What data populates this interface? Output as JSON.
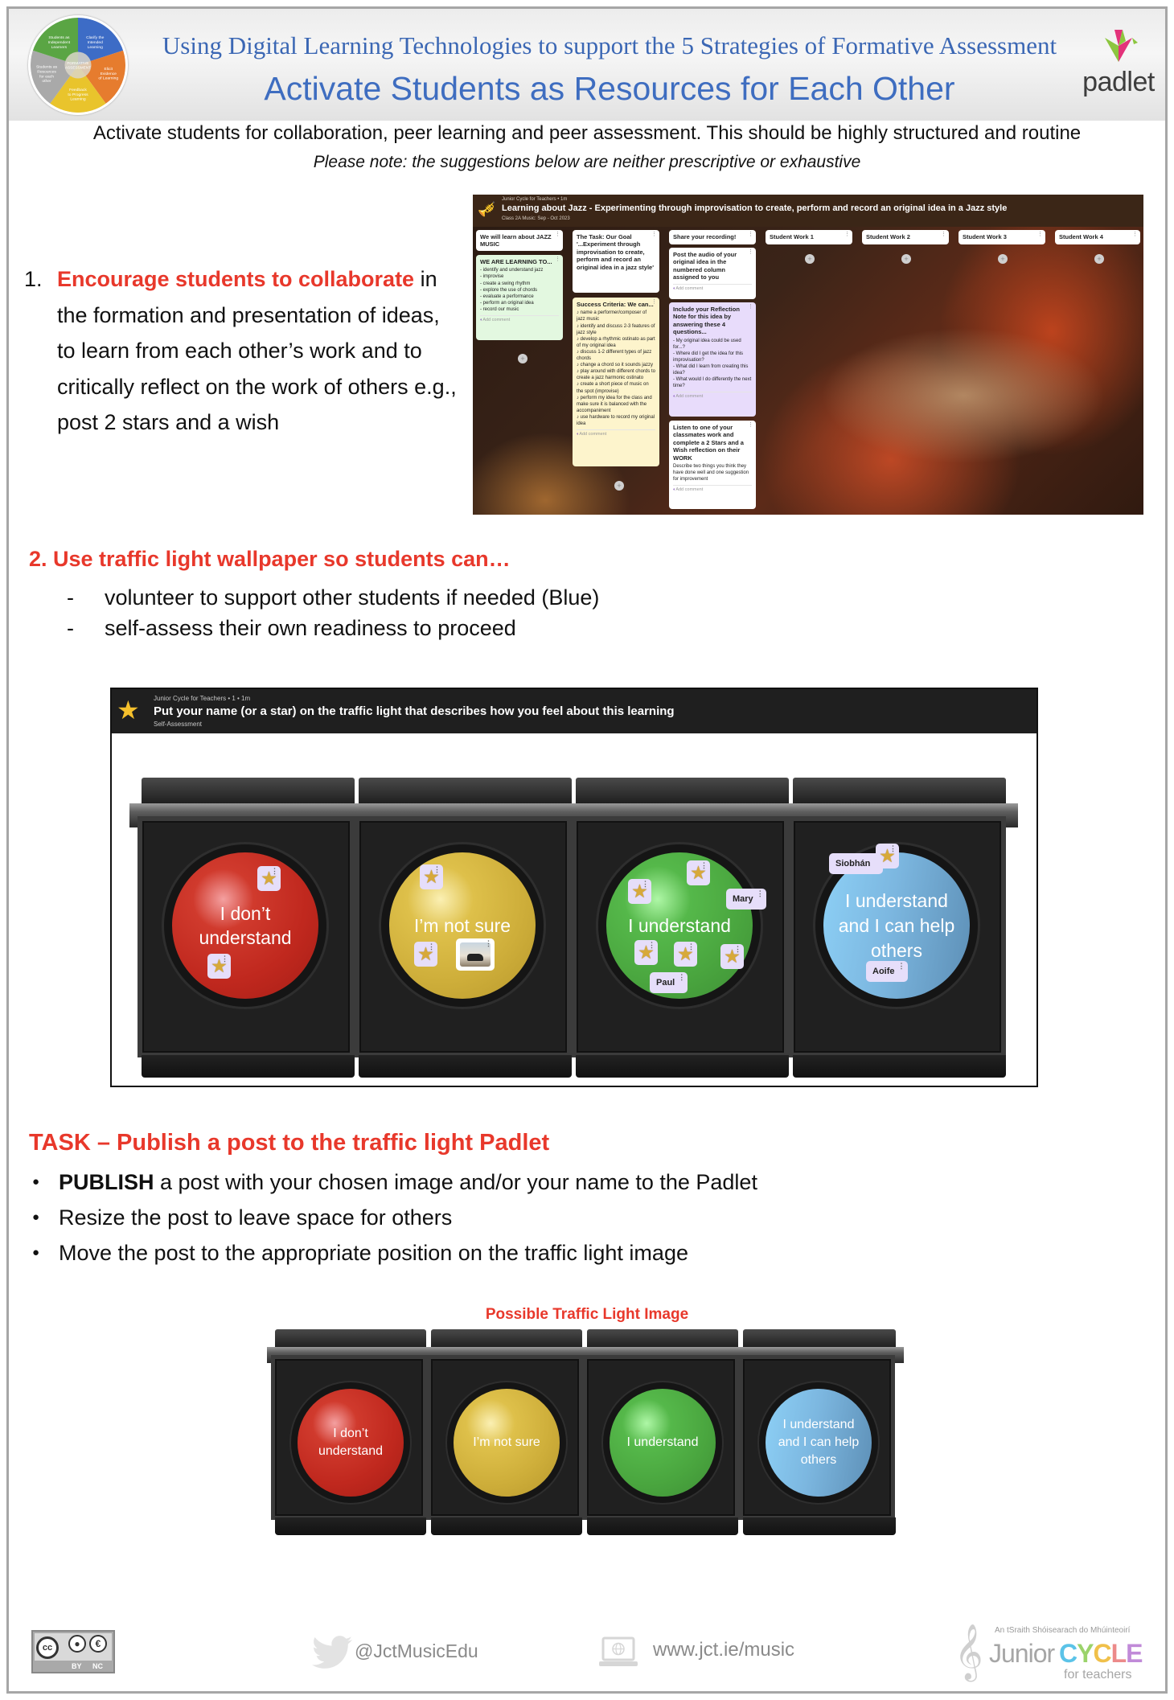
{
  "header": {
    "subtitle": "Using Digital Learning Technologies to support the 5 Strategies of Formative Assessment",
    "title": "Activate Students as Resources for Each Other",
    "brand": "padlet",
    "wheel": {
      "center": "FORMATIVE ASSESSMENT",
      "segments": [
        {
          "label": "Students as Independent Learners",
          "color": "#5aa544"
        },
        {
          "label": "Clarify the Intended Learning",
          "color": "#3d6cc6"
        },
        {
          "label": "Elicit Evidence of Learning",
          "color": "#e67c2e"
        },
        {
          "label": "Feedback to Progress Learning",
          "color": "#e9c42c"
        },
        {
          "label": "Students as Resources for each other",
          "color": "#a9a9a9"
        }
      ]
    }
  },
  "intro": "Activate students for collaboration, peer learning and peer assessment. This should be highly structured and routine",
  "note": "Please note: the suggestions below are neither prescriptive or exhaustive",
  "section1": {
    "number": "1.",
    "highlight": "Encourage students to collaborate",
    "rest": " in the formation and presentation of ideas, to learn from each other’s work and to critically reflect on the work of others e.g., post 2 stars and a wish"
  },
  "jazz_board": {
    "meta": "Junior Cycle for Teachers • 1m",
    "title": "Learning about Jazz - Experimenting through improvisation to create, perform and record an original idea in a Jazz style",
    "subtitle": "Class 2A Music: Sep - Oct 2023",
    "add_comment": "Add comment",
    "columns": [
      {
        "header": "We will learn about JAZZ MUSIC"
      },
      {
        "header": "The Task: Our Goal '...Experiment through improvisation to create, perform and record an original idea in a jazz style'"
      },
      {
        "header": "Share your recording!"
      },
      {
        "header": "Student Work 1"
      },
      {
        "header": "Student Work 2"
      },
      {
        "header": "Student Work 3"
      },
      {
        "header": "Student Work 4"
      }
    ],
    "cards": {
      "learning": {
        "title": "WE ARE LEARNING TO...",
        "body": "- identify and understand jazz\n- improvise\n- create a swing rhythm\n- explore the use of chords\n- evaluate a performance\n- perform an original idea\n- record our music"
      },
      "success": {
        "title": "Success Criteria: We can...",
        "body": "♪ name a performer/composer of jazz music\n♪ identify and discuss 2-3 features of jazz style\n♪ develop a rhythmic ostinato as part of my original idea\n♪ discuss 1-2 different types of jazz chords\n♪ change a chord so it sounds jazzy\n♪ play around with different chords to create a jazz harmonic ostinato\n♪ create a short piece of music on the spot (improvise)\n♪ perform my idea for the class and make sure it is balanced with the accompaniment\n♪ use hardware to record my original idea"
      },
      "post_audio": {
        "title": "Post the audio of your original idea in the numbered column assigned to you"
      },
      "reflection": {
        "title": "Include your Reflection Note for this idea by answering these 4 questions...",
        "body": "- My original idea could be used for...?\n- Where did I get the idea for this improvisation?\n- What did I learn from creating this idea?\n- What would I do differently the next time?"
      },
      "listen": {
        "title": "Listen to one of your classmates work and complete a 2 Stars and a Wish reflection on their WORK",
        "body": "Describe two things you think they have done well and one suggestion for improvement"
      }
    }
  },
  "section2": {
    "heading": "2. Use traffic light wallpaper so students can…",
    "items": [
      "volunteer to support other students if needed (Blue)",
      "self-assess their own readiness to proceed"
    ]
  },
  "traffic_board": {
    "meta": "Junior Cycle for Teachers • 1 • 1m",
    "title": "Put your name (or a star) on the traffic light that describes how you feel about this learning",
    "subtitle": "Self-Assessment",
    "lights": [
      {
        "label_lines": [
          "I don’t",
          "understand"
        ],
        "color": "red"
      },
      {
        "label_lines": [
          "I’m not sure"
        ],
        "color": "yellow"
      },
      {
        "label_lines": [
          "I understand"
        ],
        "color": "green"
      },
      {
        "label_lines": [
          "I understand",
          "and I can help",
          "others"
        ],
        "color": "blue"
      }
    ],
    "posts": {
      "red": [
        "star",
        "star"
      ],
      "yellow": [
        "star",
        "star",
        "image"
      ],
      "green": [
        "star",
        "star",
        "Mary",
        "star",
        "star",
        "star",
        "Paul"
      ],
      "blue": [
        "Siobhán",
        "star",
        "Aoife"
      ]
    },
    "names": {
      "mary": "Mary",
      "paul": "Paul",
      "siobhan": "Siobhán",
      "aoife": "Aoife"
    }
  },
  "task": {
    "heading": "TASK – Publish a post to the traffic light Padlet",
    "items": [
      {
        "bold": "PUBLISH",
        "text": " a post with your chosen image and/or your name to the Padlet"
      },
      {
        "bold": "",
        "text": "Resize the post to leave space for others"
      },
      {
        "bold": "",
        "text": "Move the post to the appropriate position on the traffic light image"
      }
    ]
  },
  "possible_image": {
    "caption": "Possible Traffic Light Image",
    "lights": [
      {
        "l1": "I don’t",
        "l2": "understand",
        "l3": ""
      },
      {
        "l1": "I’m not sure",
        "l2": "",
        "l3": ""
      },
      {
        "l1": "I understand",
        "l2": "",
        "l3": ""
      },
      {
        "l1": "I understand",
        "l2": "and I can help",
        "l3": "others"
      }
    ]
  },
  "footer": {
    "license": {
      "cc": "cc",
      "by": "BY",
      "nc": "NC"
    },
    "twitter": "@JctMusicEdu",
    "website": "www.jct.ie/music",
    "jct": {
      "irish": "An tSraith Shóisearach do Mhúinteoirí",
      "junior": "Junior",
      "cycle": "CYCLE",
      "for_teachers": "for teachers"
    }
  },
  "colors": {
    "title_blue": "#3e6dc0",
    "accent_red": "#e8382b",
    "frame_gray": "#a6a6a6"
  }
}
